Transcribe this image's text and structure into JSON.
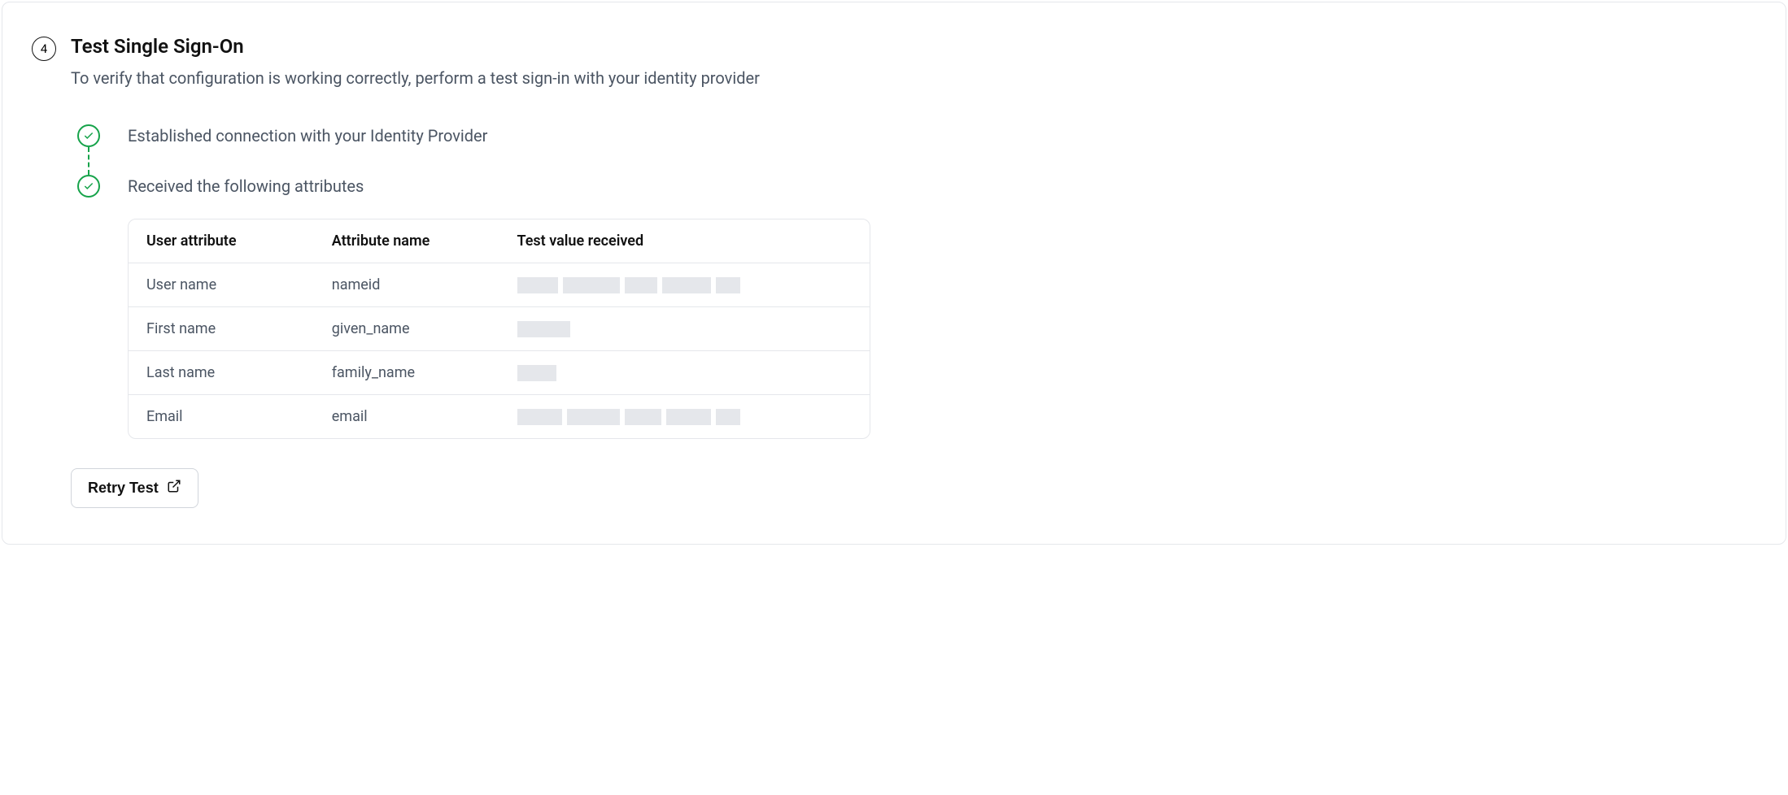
{
  "step": {
    "number": "4",
    "title": "Test Single Sign-On",
    "subtitle": "To verify that configuration is working correctly, perform a test sign-in with your identity provider"
  },
  "status": {
    "connection": "Established connection with your Identity Provider",
    "attributes": "Received the following attributes"
  },
  "table": {
    "headers": {
      "user_attribute": "User attribute",
      "attribute_name": "Attribute name",
      "test_value": "Test value received"
    },
    "rows": [
      {
        "user_attribute": "User name",
        "attribute_name": "nameid",
        "redacted_widths": [
          50,
          70,
          40,
          60,
          30
        ]
      },
      {
        "user_attribute": "First name",
        "attribute_name": "given_name",
        "redacted_widths": [
          65
        ]
      },
      {
        "user_attribute": "Last name",
        "attribute_name": "family_name",
        "redacted_widths": [
          48
        ]
      },
      {
        "user_attribute": "Email",
        "attribute_name": "email",
        "redacted_widths": [
          55,
          65,
          45,
          55,
          30
        ]
      }
    ]
  },
  "buttons": {
    "retry": "Retry Test"
  }
}
